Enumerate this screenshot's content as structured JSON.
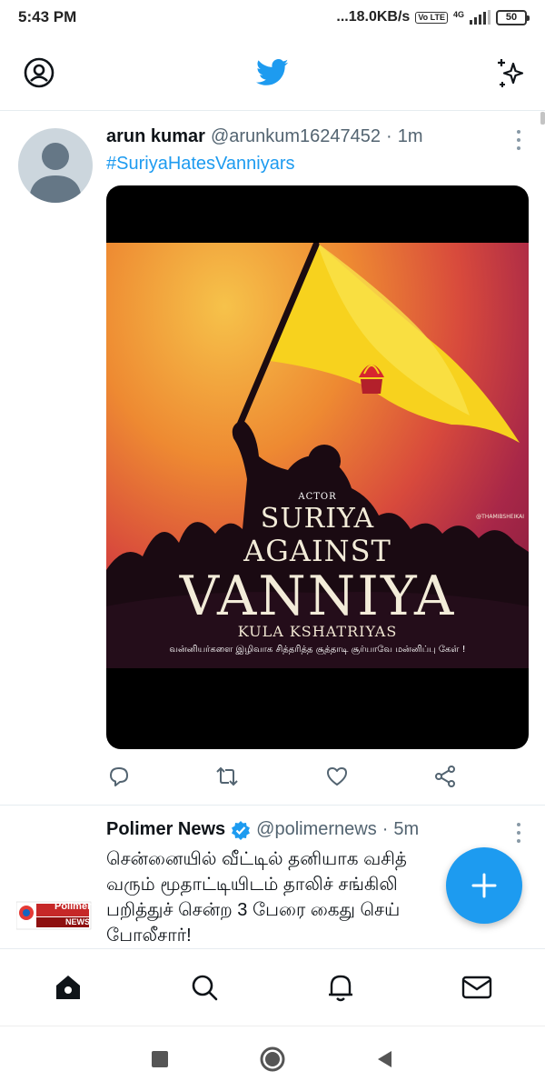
{
  "status_bar": {
    "time": "5:43 PM",
    "network_speed": "...18.0KB/s",
    "volte": "Vo LTE",
    "network_type": "4G",
    "battery": "50"
  },
  "header": {
    "profile_icon": "profile-circle-icon",
    "logo_icon": "twitter-bird-icon",
    "sparkle_icon": "sparkle-icon"
  },
  "tweets": [
    {
      "display_name": "arun kumar",
      "handle": "@arunkum16247452",
      "separator": "·",
      "time": "1m",
      "text": "#SuriyaHatesVanniyars",
      "media": {
        "actor": "ACTOR",
        "line1": "SURIYA",
        "line2": "AGAINST",
        "line3": "VANNIYA",
        "line4": "KULA KSHATRIYAS",
        "line5": "வன்னியர்களை இழிவாக சித்தரித்த சூத்தாடி சூர்யாவே மன்னிப்பு கேள் !",
        "watermark": "@THAMIBSHEIKAI"
      }
    },
    {
      "display_name": "Polimer News",
      "handle": "@polimernews",
      "separator": "·",
      "time": "5m",
      "avatar_text_top": "Polimer",
      "avatar_text_bottom": "NEWS",
      "text_lines": [
        "சென்னையில் வீட்டில் தனியாக வசித்",
        "வரும் மூதாட்டியிடம் தாலிச் சங்கிலி",
        "பறித்துச் சென்ற 3 பேரை கைது செய்",
        "போலீசார்!"
      ]
    }
  ],
  "colors": {
    "brand_blue": "#1d9bf0",
    "text_primary": "#0f1419",
    "text_secondary": "#536471"
  },
  "bottom_nav": [
    "home-icon",
    "search-icon",
    "notifications-icon",
    "messages-icon"
  ],
  "system_nav": [
    "recents-square-icon",
    "home-circle-icon",
    "back-triangle-icon"
  ]
}
